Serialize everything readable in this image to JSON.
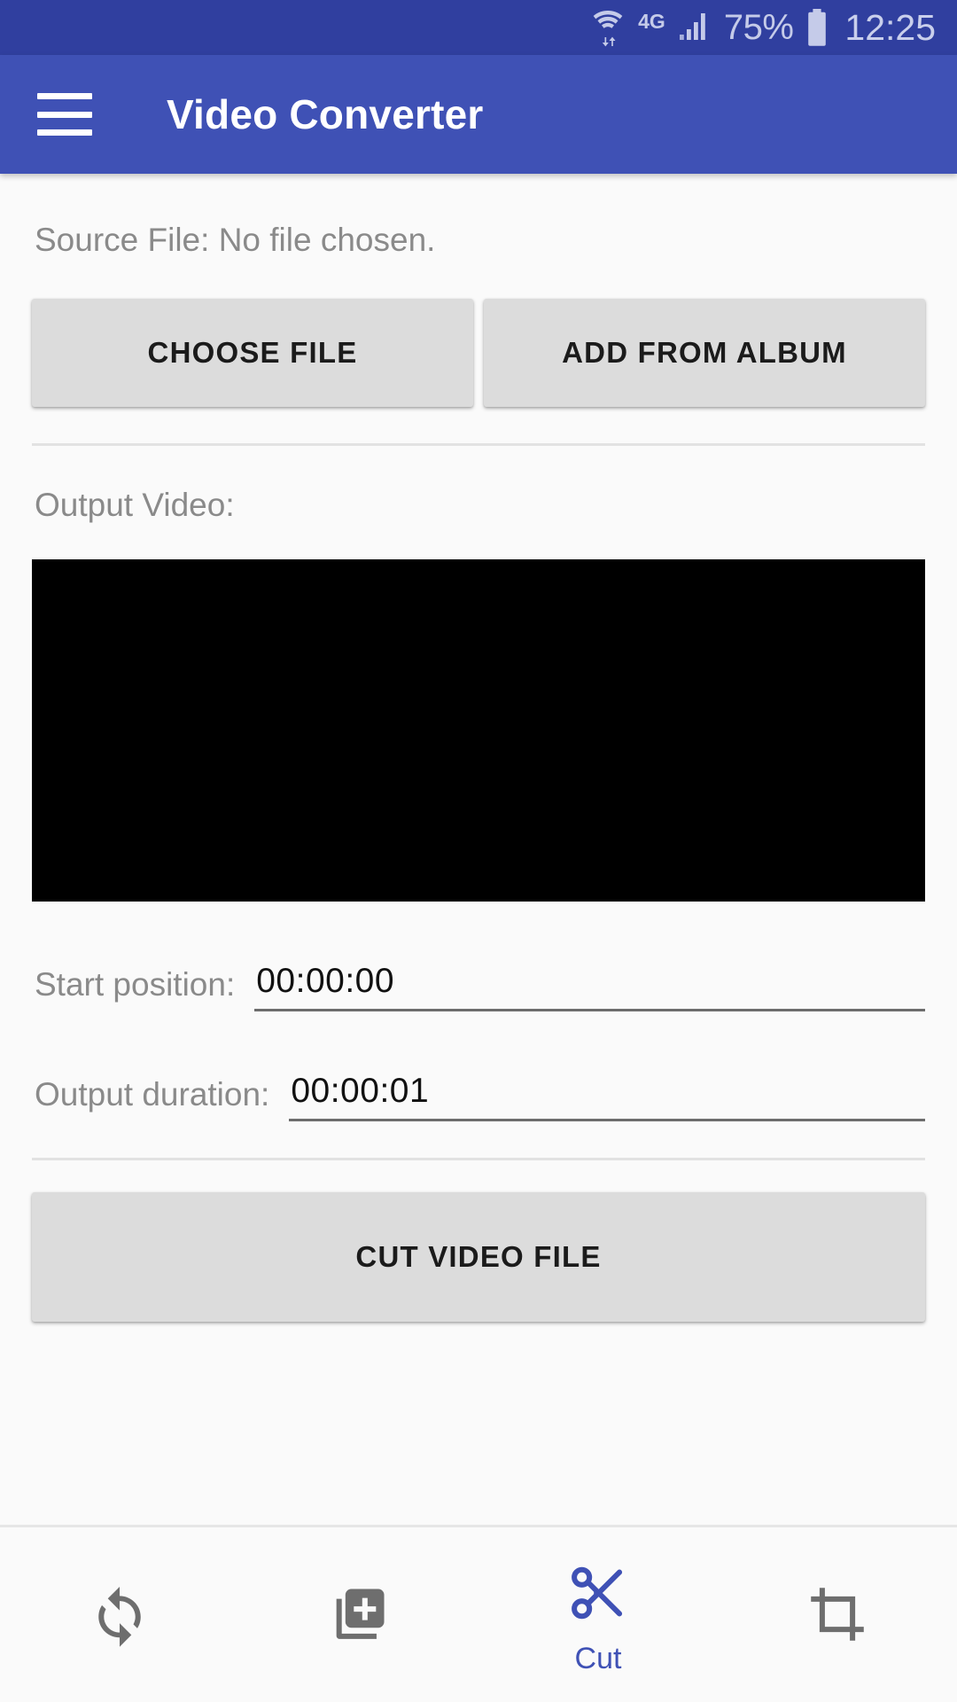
{
  "status_bar": {
    "wifi_icon": "wifi-with-transfer-arrows-icon",
    "network_type": "4G",
    "signal_icon": "cellular-signal-icon",
    "battery_percent": "75%",
    "battery_icon": "battery-icon",
    "clock": "12:25"
  },
  "app_bar": {
    "menu_icon": "hamburger-menu-icon",
    "title": "Video Converter"
  },
  "main": {
    "source_file_label": "Source File: No file chosen.",
    "choose_file_label": "CHOOSE FILE",
    "add_from_album_label": "ADD FROM ALBUM",
    "output_video_label": "Output Video:",
    "start_position_label": "Start position:",
    "start_position_value": "00:00:00",
    "start_position_placeholder": "00:00:00",
    "output_duration_label": "Output duration:",
    "output_duration_value": "00:00:01",
    "output_duration_placeholder": "00:00:01",
    "cut_video_file_label": "CUT VIDEO FILE"
  },
  "bottom_nav": {
    "items": [
      {
        "icon": "convert-refresh-icon",
        "label": "",
        "active": false
      },
      {
        "icon": "library-add-icon",
        "label": "",
        "active": false
      },
      {
        "icon": "scissors-cut-icon",
        "label": "Cut",
        "active": true
      },
      {
        "icon": "crop-icon",
        "label": "",
        "active": false
      }
    ]
  },
  "colors": {
    "status_bar_bg": "#303f9f",
    "app_bar_bg": "#3f51b5",
    "accent": "#3f51b5",
    "page_bg": "#fafafa",
    "button_bg": "#dcdcdc",
    "label_gray": "#8a8a8a",
    "icon_gray": "#6e6e6e",
    "video_bg": "#000000"
  }
}
